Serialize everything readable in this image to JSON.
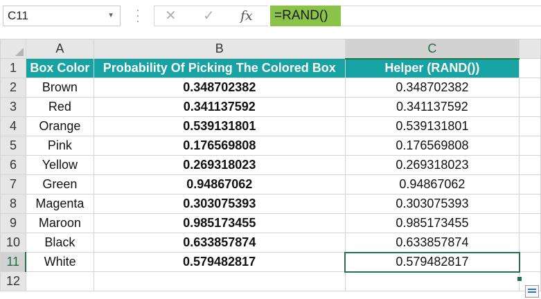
{
  "formula_bar": {
    "name_box": "C11",
    "cancel_icon": "✕",
    "enter_icon": "✓",
    "fx_label": "fx",
    "formula": "=RAND()"
  },
  "columns": [
    "A",
    "B",
    "C"
  ],
  "headers": [
    "Box Color",
    "Probability Of Picking The Colored Box",
    "Helper (RAND())"
  ],
  "rows": [
    {
      "num": "2",
      "color": "Brown",
      "prob": "0.348702382",
      "helper": "0.348702382"
    },
    {
      "num": "3",
      "color": "Red",
      "prob": "0.341137592",
      "helper": "0.341137592"
    },
    {
      "num": "4",
      "color": "Orange",
      "prob": "0.539131801",
      "helper": "0.539131801"
    },
    {
      "num": "5",
      "color": "Pink",
      "prob": "0.176569808",
      "helper": "0.176569808"
    },
    {
      "num": "6",
      "color": "Yellow",
      "prob": "0.269318023",
      "helper": "0.269318023"
    },
    {
      "num": "7",
      "color": "Green",
      "prob": "0.94867062",
      "helper": "0.94867062"
    },
    {
      "num": "8",
      "color": "Magenta",
      "prob": "0.303075393",
      "helper": "0.303075393"
    },
    {
      "num": "9",
      "color": "Maroon",
      "prob": "0.985173455",
      "helper": "0.985173455"
    },
    {
      "num": "10",
      "color": "Black",
      "prob": "0.633857874",
      "helper": "0.633857874"
    },
    {
      "num": "11",
      "color": "White",
      "prob": "0.579482817",
      "helper": "0.579482817"
    }
  ],
  "row_labels": {
    "header_row": "1",
    "last_row": "12"
  },
  "colors": {
    "header_fill": "#17a2a4",
    "formula_highlight": "#8bc34a",
    "selection": "#217346"
  }
}
